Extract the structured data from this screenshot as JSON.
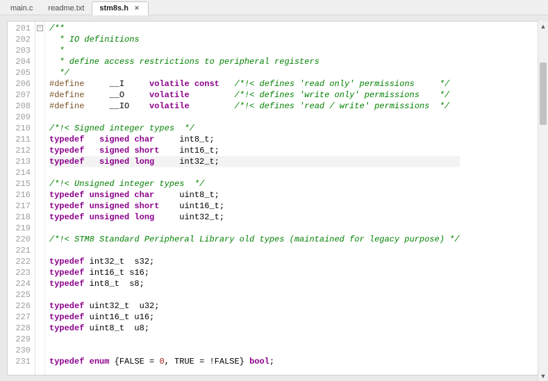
{
  "tabs": [
    {
      "label": "main.c",
      "active": false,
      "closeable": false
    },
    {
      "label": "readme.txt",
      "active": false,
      "closeable": false
    },
    {
      "label": "stm8s.h",
      "active": true,
      "closeable": true
    }
  ],
  "fold_glyph": "−",
  "close_glyph": "×",
  "scroll_up_glyph": "▲",
  "scroll_down_glyph": "▼",
  "first_line_number": 201,
  "highlighted_line_index": 12,
  "fold_mark_line_index": 0,
  "code_lines": [
    [
      {
        "cls": "c-comment",
        "t": "/**"
      }
    ],
    [
      {
        "cls": "c-comment",
        "t": "  * IO definitions"
      }
    ],
    [
      {
        "cls": "c-comment",
        "t": "  *"
      }
    ],
    [
      {
        "cls": "c-comment",
        "t": "  * define access restrictions to peripheral registers"
      }
    ],
    [
      {
        "cls": "c-comment",
        "t": "  */"
      }
    ],
    [
      {
        "cls": "c-pre",
        "t": "#define"
      },
      {
        "t": "     __I     "
      },
      {
        "cls": "c-kw",
        "t": "volatile const"
      },
      {
        "t": "   "
      },
      {
        "cls": "c-comment",
        "t": "/*!< defines 'read only' permissions     */"
      }
    ],
    [
      {
        "cls": "c-pre",
        "t": "#define"
      },
      {
        "t": "     __O     "
      },
      {
        "cls": "c-kw",
        "t": "volatile"
      },
      {
        "t": "         "
      },
      {
        "cls": "c-comment",
        "t": "/*!< defines 'write only' permissions    */"
      }
    ],
    [
      {
        "cls": "c-pre",
        "t": "#define"
      },
      {
        "t": "     __IO    "
      },
      {
        "cls": "c-kw",
        "t": "volatile"
      },
      {
        "t": "         "
      },
      {
        "cls": "c-comment",
        "t": "/*!< defines 'read / write' permissions  */"
      }
    ],
    [],
    [
      {
        "cls": "c-comment",
        "t": "/*!< Signed integer types  */"
      }
    ],
    [
      {
        "cls": "c-kw",
        "t": "typedef"
      },
      {
        "t": "   "
      },
      {
        "cls": "c-kw",
        "t": "signed char"
      },
      {
        "t": "     int8_t;"
      }
    ],
    [
      {
        "cls": "c-kw",
        "t": "typedef"
      },
      {
        "t": "   "
      },
      {
        "cls": "c-kw",
        "t": "signed short"
      },
      {
        "t": "    int16_t;"
      }
    ],
    [
      {
        "cls": "c-kw",
        "t": "typedef"
      },
      {
        "t": "   "
      },
      {
        "cls": "c-kw",
        "t": "signed long"
      },
      {
        "t": "     int32_t;"
      }
    ],
    [],
    [
      {
        "cls": "c-comment",
        "t": "/*!< Unsigned integer types  */"
      }
    ],
    [
      {
        "cls": "c-kw",
        "t": "typedef"
      },
      {
        "t": " "
      },
      {
        "cls": "c-kw",
        "t": "unsigned char"
      },
      {
        "t": "     uint8_t;"
      }
    ],
    [
      {
        "cls": "c-kw",
        "t": "typedef"
      },
      {
        "t": " "
      },
      {
        "cls": "c-kw",
        "t": "unsigned short"
      },
      {
        "t": "    uint16_t;"
      }
    ],
    [
      {
        "cls": "c-kw",
        "t": "typedef"
      },
      {
        "t": " "
      },
      {
        "cls": "c-kw",
        "t": "unsigned long"
      },
      {
        "t": "     uint32_t;"
      }
    ],
    [],
    [
      {
        "cls": "c-comment",
        "t": "/*!< STM8 Standard Peripheral Library old types (maintained for legacy purpose) */"
      }
    ],
    [],
    [
      {
        "cls": "c-kw",
        "t": "typedef"
      },
      {
        "t": " int32_t  s32;"
      }
    ],
    [
      {
        "cls": "c-kw",
        "t": "typedef"
      },
      {
        "t": " int16_t s16;"
      }
    ],
    [
      {
        "cls": "c-kw",
        "t": "typedef"
      },
      {
        "t": " int8_t  s8;"
      }
    ],
    [],
    [
      {
        "cls": "c-kw",
        "t": "typedef"
      },
      {
        "t": " uint32_t  u32;"
      }
    ],
    [
      {
        "cls": "c-kw",
        "t": "typedef"
      },
      {
        "t": " uint16_t u16;"
      }
    ],
    [
      {
        "cls": "c-kw",
        "t": "typedef"
      },
      {
        "t": " uint8_t  u8;"
      }
    ],
    [],
    [],
    [
      {
        "cls": "c-kw",
        "t": "typedef"
      },
      {
        "t": " "
      },
      {
        "cls": "c-kw",
        "t": "enum"
      },
      {
        "t": " {FALSE = "
      },
      {
        "cls": "c-num",
        "t": "0"
      },
      {
        "t": ", TRUE = !FALSE} "
      },
      {
        "cls": "c-kw",
        "t": "bool"
      },
      {
        "t": ";"
      }
    ]
  ]
}
